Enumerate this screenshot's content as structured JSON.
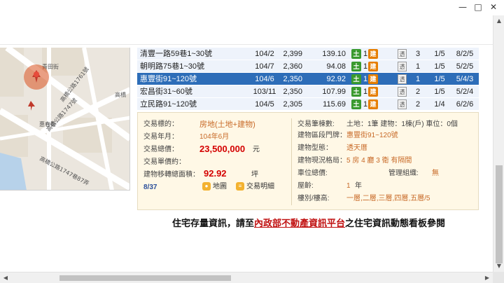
{
  "window": {
    "min_glyph": "—",
    "max_glyph": "□",
    "close_glyph": "✕"
  },
  "map": {
    "streets": [
      "青田街",
      "高橋公路1761號",
      "高橋公路1747號",
      "惠春街",
      "高橋公路1747巷87弄",
      "高橋"
    ],
    "marker_color": "#d9501e"
  },
  "listing": {
    "rows": [
      {
        "address": "清豐一路59巷1~30號",
        "date": "104/2",
        "price": "2,399",
        "size": "139.10",
        "tu": "土",
        "tu_count": "1",
        "jian": "建",
        "tou": "透",
        "rooms": "3",
        "floor": "1/5",
        "layout": "8/2/5",
        "selected": false
      },
      {
        "address": "朝明路75巷1~30號",
        "date": "104/7",
        "price": "2,360",
        "size": "94.08",
        "tu": "土",
        "tu_count": "1",
        "jian": "建",
        "tou": "透",
        "rooms": "1",
        "floor": "1/5",
        "layout": "5/2/5",
        "selected": false
      },
      {
        "address": "惠豐街91~120號",
        "date": "104/6",
        "price": "2,350",
        "size": "92.92",
        "tu": "土",
        "tu_count": "1",
        "jian": "建",
        "tou": "透",
        "rooms": "1",
        "floor": "1/5",
        "layout": "5/4/3",
        "selected": true
      },
      {
        "address": "宏昌街31~60號",
        "date": "103/11",
        "price": "2,350",
        "size": "107.99",
        "tu": "土",
        "tu_count": "1",
        "jian": "建",
        "tou": "透",
        "rooms": "2",
        "floor": "1/5",
        "layout": "5/2/4",
        "selected": false
      },
      {
        "address": "立民路91~120號",
        "date": "104/5",
        "price": "2,305",
        "size": "115.69",
        "tu": "土",
        "tu_count": "1",
        "jian": "建",
        "tou": "透",
        "rooms": "2",
        "floor": "1/4",
        "layout": "6/2/6",
        "selected": false
      }
    ]
  },
  "detail": {
    "left": {
      "target_label": "交易標的：",
      "target_value": "房地(土地+建物)",
      "date_label": "交易年月：",
      "date_value": "104年6月",
      "total_label": "交易總價：",
      "total_value": "23,500,000",
      "total_unit": "元",
      "unit_price_label": "交易單價約：",
      "area_label": "建物移轉總面積：",
      "area_value": "92.92",
      "area_unit": "坪",
      "page_indicator": "8/37",
      "map_button": "地圖",
      "detail_button": "交易明細"
    },
    "right": {
      "count_label": "交易筆棟數:",
      "count_value": "土地：1筆 建物：1棟(戶) 車位：0個",
      "address_label": "建物區段門牌：",
      "address_value": "惠豐街91~120號",
      "type_label": "建物型態：",
      "type_value": "透天厝",
      "layout_label": "建物現況格局：",
      "layout_value": "5 房 4 廳 3 衛 有隔間",
      "parking_label": "車位總價:",
      "mgmt_label": "管理組織:",
      "mgmt_value": "無",
      "age_label": "屋齡:",
      "age_value": "1",
      "age_unit": "年",
      "floors_label": "樓別/樓高:",
      "floors_value": "一層,二層,三層,四層,五層/5"
    }
  },
  "footer": {
    "prefix": "住宅存量資訊，請至",
    "link": "內政部不動產資訊平台",
    "suffix": "之住宅資訊動態看板參閱"
  }
}
